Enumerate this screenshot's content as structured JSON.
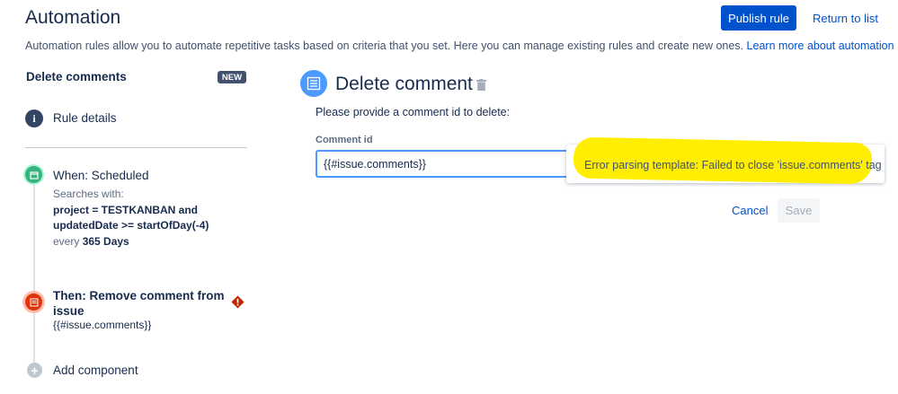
{
  "header": {
    "title": "Automation",
    "publish_label": "Publish rule",
    "return_label": "Return to list",
    "description": "Automation rules allow you to automate repetitive tasks based on criteria that you set. Here you can manage existing rules and create new ones.",
    "learn_more": "Learn more about automation"
  },
  "sidebar": {
    "rule_name": "Delete comments",
    "badge": "NEW",
    "rule_details": "Rule details",
    "trigger": {
      "title": "When: Scheduled",
      "sub": "Searches with:",
      "jql": "project = TESTKANBAN and updatedDate >= startOfDay(-4)",
      "every_prefix": "every",
      "every_value": "365 Days"
    },
    "action": {
      "title": "Then: Remove comment from issue",
      "sub": "{{#issue.comments}}"
    },
    "add_component": "Add component"
  },
  "component": {
    "title": "Delete comment",
    "prompt": "Please provide a comment id to delete:",
    "field_label": "Comment id",
    "field_value": "{{#issue.comments}}",
    "error": "Error parsing template: Failed to close 'issue.comments' tag",
    "cancel_label": "Cancel",
    "save_label": "Save"
  },
  "colors": {
    "primary": "#0052cc",
    "trigger": "#36b37e",
    "action": "#de350b",
    "component": "#4c9aff",
    "highlight": "#ffee00"
  }
}
